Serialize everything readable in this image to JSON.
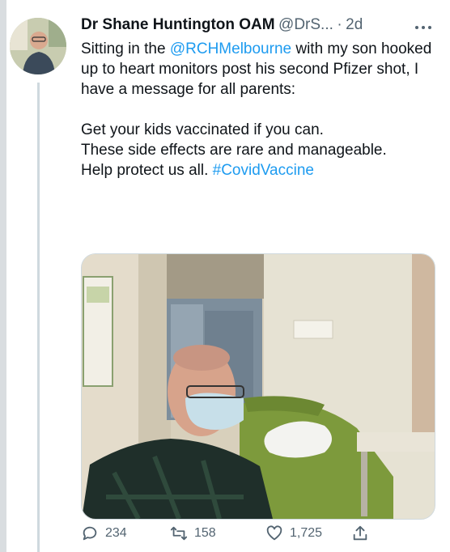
{
  "tweet": {
    "display_name": "Dr Shane Huntington OAM",
    "handle": "@DrS...",
    "separator": "·",
    "time": "2d",
    "text": {
      "line1_prefix": "Sitting in the ",
      "mention": "@RCHMelbourne",
      "line1_suffix": " with my son hooked up to heart monitors post his second Pfizer shot, I have a message for all parents:",
      "para2": "Get your kids vaccinated if you can.",
      "para3": "These side effects are rare and manageable.",
      "para4_prefix": "Help protect us all. ",
      "hashtag": "#CovidVaccine"
    }
  },
  "actions": {
    "reply_count": "234",
    "retweet_count": "158",
    "like_count": "1,725"
  },
  "icons": [
    "more-icon",
    "reply-icon",
    "retweet-icon",
    "like-icon",
    "share-icon"
  ],
  "colors": {
    "link": "#1d9bf0",
    "secondary": "#536471",
    "text": "#0f1419"
  }
}
